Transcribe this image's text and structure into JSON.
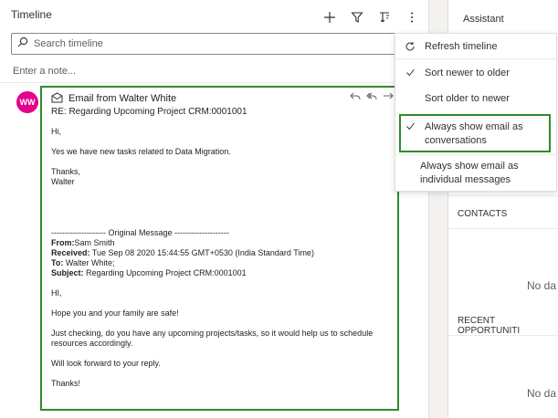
{
  "timeline": {
    "title": "Timeline",
    "search_placeholder": "Search timeline",
    "note_placeholder": "Enter a note...",
    "avatar_initials": "WW",
    "icons": [
      "add-icon",
      "filter-icon",
      "sort-icon",
      "more-icon"
    ]
  },
  "email": {
    "title": "Email from Walter White",
    "subject": "RE: Regarding Upcoming Project CRM:0001001",
    "greeting": "Hi,",
    "line1": "Yes we have new tasks related to Data Migration.",
    "thanks": "Thanks,",
    "signature": "Walter",
    "separator": "-------------------- Original Message --------------------",
    "from_label": "From:",
    "from_value": "Sam Smith",
    "received_label": "Received:",
    "received_value": " Tue Sep 08 2020 15:44:55 GMT+0530 (India Standard Time)",
    "to_label": "To:",
    "to_value": " Walter White;",
    "subject_label": "Subject:",
    "subject_value": " Regarding Upcoming Project CRM:0001001",
    "hi": "HI,",
    "p1": "Hope you and your family are safe!",
    "p2": "Just checking, do you have any upcoming projects/tasks, so it would help us to schedule resources accordingly.",
    "p3": "Will look forward to your reply.",
    "closing": "Thanks!"
  },
  "menu": {
    "refresh": "Refresh timeline",
    "sort_newer": "Sort newer to older",
    "sort_older": "Sort older to newer",
    "show_conversations": "Always show email as conversations",
    "show_individual": "Always show email as individual messages"
  },
  "assistant": {
    "title": "Assistant",
    "contacts": "CONTACTS",
    "nodata1": "No da",
    "opportunities": "RECENT OPPORTUNITI",
    "nodata2": "No da"
  },
  "colors": {
    "accent_green": "#2e8b2e",
    "avatar": "#e3008c"
  }
}
